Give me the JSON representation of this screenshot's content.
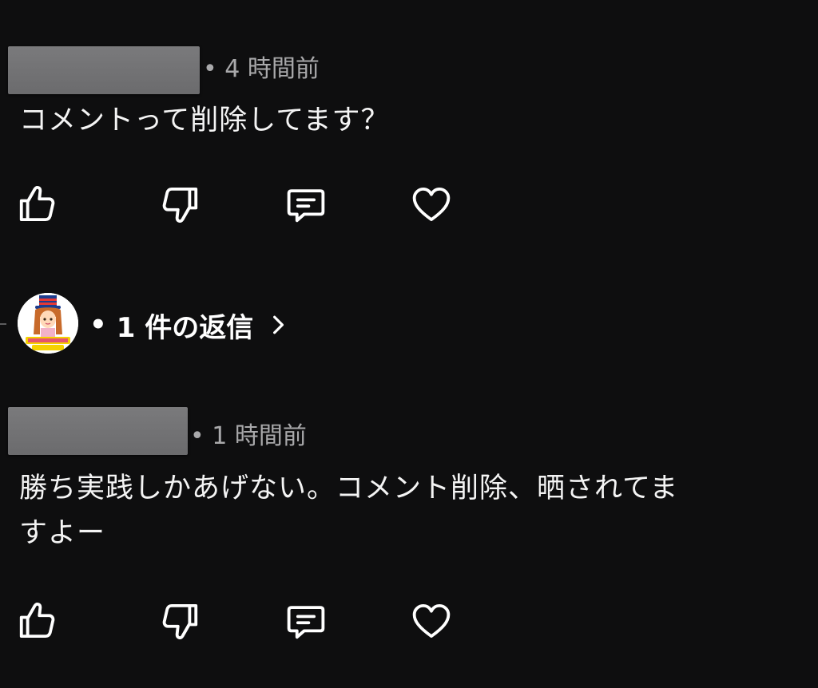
{
  "comments": [
    {
      "time": "• 4 時間前",
      "text_lines": [
        "コメントって削除してます？"
      ],
      "actions": [
        "like-icon",
        "dislike-icon",
        "reply-icon",
        "heart-icon"
      ]
    },
    {
      "time": "• 1 時間前",
      "text_lines": [
        "勝ち実践しかあげない。コメント削除、晒されてま",
        "すよー"
      ],
      "actions": [
        "like-icon",
        "dislike-icon",
        "reply-icon",
        "heart-icon"
      ]
    }
  ],
  "replies": {
    "dot": "•",
    "label": "1 件の返信",
    "chevron": "chevron-right-icon"
  },
  "colors": {
    "background": "#0e0e0f",
    "text": "#f4f4f4",
    "meta": "#a9a9ab",
    "redacted": "#727274"
  }
}
